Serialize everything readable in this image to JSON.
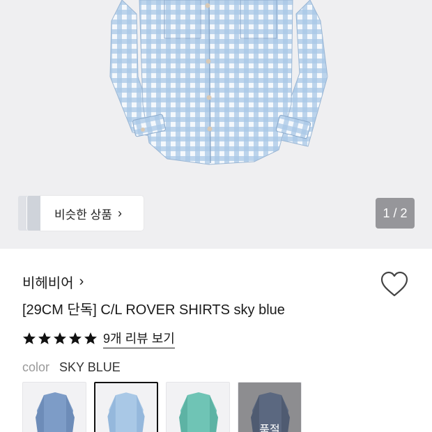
{
  "hero": {
    "similar_label": "비슷한 상품",
    "similar_chevron": "›",
    "pager": "1 / 2"
  },
  "product": {
    "brand": "비헤비어",
    "brand_chevron": "›",
    "title": "[29CM 단독] C/L ROVER SHIRTS sky blue",
    "rating_stars": 5,
    "review_link": "9개 리뷰 보기",
    "color_label": "color",
    "color_value": "SKY BLUE"
  },
  "swatches": [
    {
      "name": "blue-denim",
      "tone": "#7d9cc7",
      "selected": false,
      "soldout": false
    },
    {
      "name": "sky-blue",
      "tone": "#a9c8e6",
      "selected": true,
      "soldout": false
    },
    {
      "name": "mint",
      "tone": "#6fc4b5",
      "selected": false,
      "soldout": false
    },
    {
      "name": "navy",
      "tone": "#5b6880",
      "selected": false,
      "soldout": true,
      "soldout_label": "품절"
    }
  ],
  "colors": {
    "hero_bg": "#efeff1",
    "shirt_blue": "#a9c8e6",
    "text": "#1a1a1a",
    "muted": "#999999"
  },
  "icons": [
    "heart-icon",
    "star-icon",
    "chevron-right-icon"
  ]
}
